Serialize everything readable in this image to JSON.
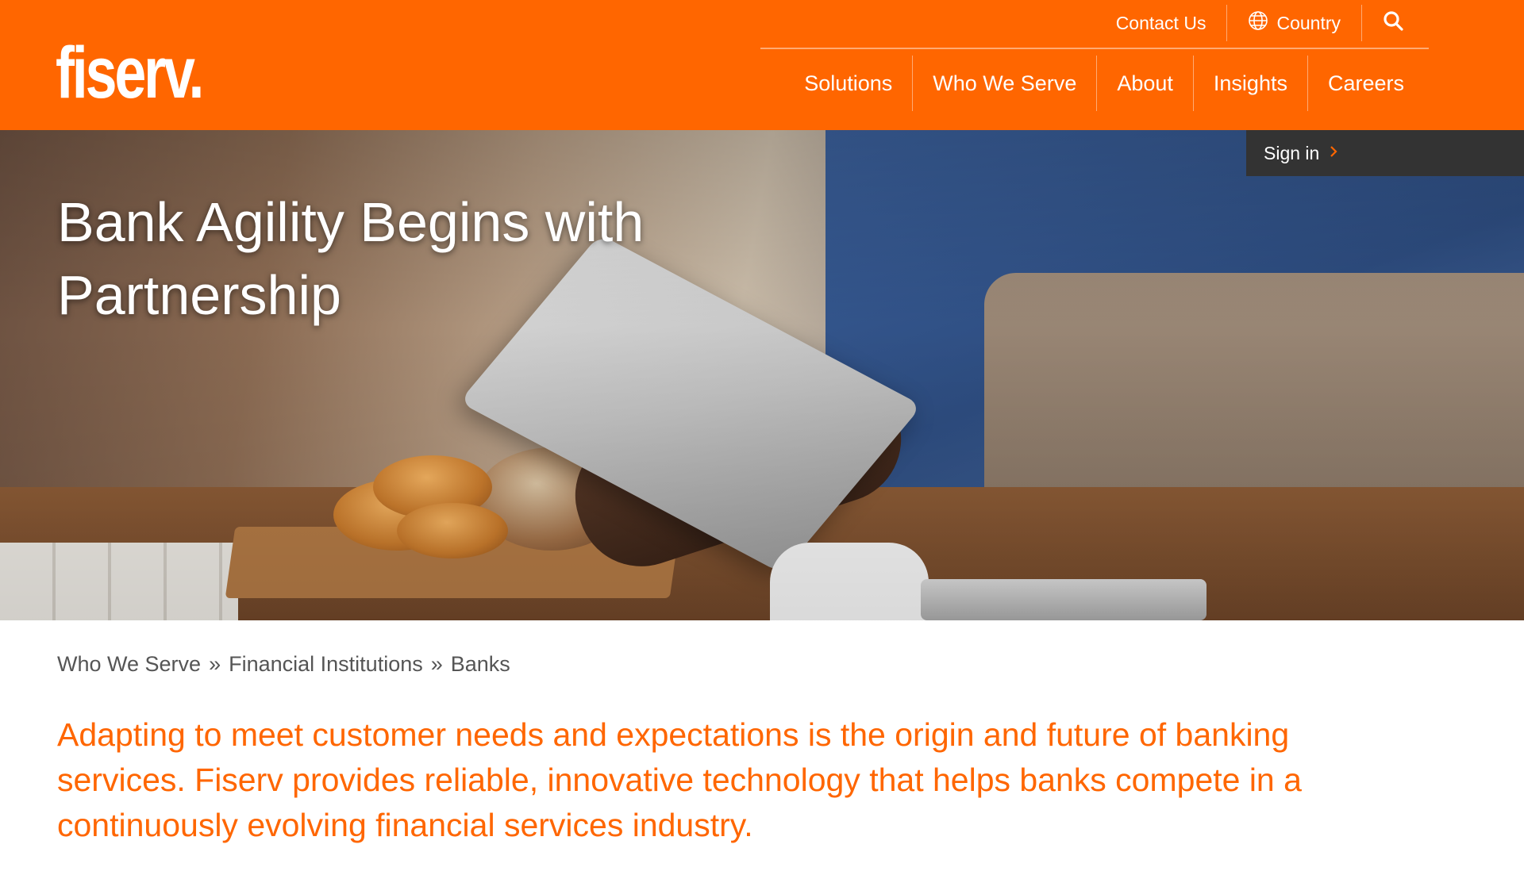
{
  "brand": {
    "logo_text": "fiserv.",
    "accent_color": "#ff6600",
    "dark_color": "#333333"
  },
  "utility_nav": {
    "contact_label": "Contact Us",
    "country_label": "Country",
    "country_icon": "globe-icon",
    "search_icon": "search-icon"
  },
  "main_nav": {
    "items": [
      {
        "label": "Solutions"
      },
      {
        "label": "Who We Serve"
      },
      {
        "label": "About"
      },
      {
        "label": "Insights"
      },
      {
        "label": "Careers"
      }
    ]
  },
  "hero": {
    "title": "Bank Agility Begins with Partnership",
    "signin_label": "Sign in",
    "signin_icon": "chevron-right-icon"
  },
  "breadcrumb": {
    "items": [
      "Who We Serve",
      "Financial Institutions",
      "Banks"
    ],
    "separator": "»"
  },
  "intro": {
    "text": "Adapting to meet customer needs and expectations is the origin and future of banking services. Fiserv provides reliable, innovative technology that helps banks compete in a continuously evolving financial services industry."
  }
}
